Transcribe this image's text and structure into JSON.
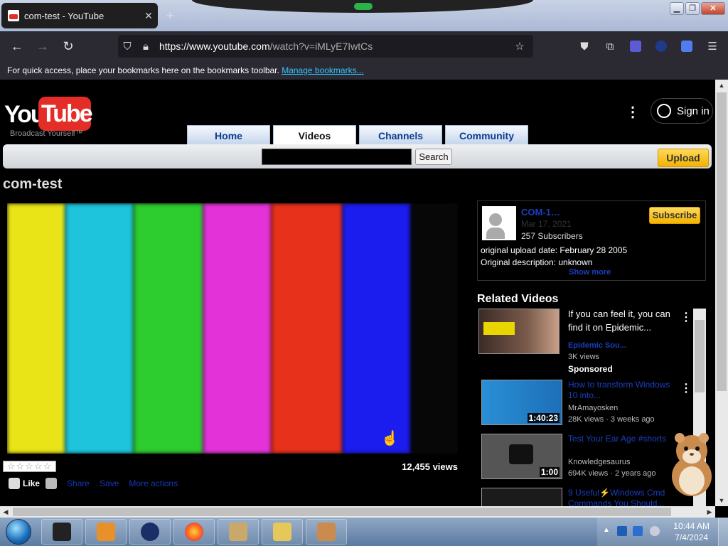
{
  "browser": {
    "tab_title": "com-test - YouTube",
    "url_domain": "https://www.youtube.com",
    "url_path": "/watch?v=iMLyE7IwtCs",
    "bookmarks_message": "For quick access, place your bookmarks here on the bookmarks toolbar.",
    "manage_bookmarks": "Manage bookmarks..."
  },
  "site": {
    "logo_you": "You",
    "logo_tube": "Tube",
    "tagline": "Broadcast Yourself™",
    "tabs": [
      {
        "label": "Home"
      },
      {
        "label": "Videos"
      },
      {
        "label": "Channels"
      },
      {
        "label": "Community"
      }
    ],
    "search_button": "Search",
    "upload_button": "Upload",
    "sign_in": "Sign in"
  },
  "video": {
    "channel_title": "com-test",
    "views": "12,455 views",
    "rating_stars": "☆☆☆☆☆",
    "like_label": "Like",
    "share_label": "Share",
    "save_label": "Save",
    "more_actions_label": "More actions",
    "bar_colors": [
      "#e8e417",
      "#1dc4dc",
      "#2dcc2f",
      "#e432d9",
      "#e8311a",
      "#1b1cee",
      "#070707"
    ]
  },
  "channel_info": {
    "name": "COM-1…",
    "date": "Mar 17, 2021",
    "subscribers": "257 Subscribers",
    "subscribe_button": "Subscribe",
    "upload_date_line": "original upload date: February 28 2005",
    "description_line": "Original description: unknown",
    "show_more": "Show more"
  },
  "related": {
    "header": "Related Videos",
    "items": [
      {
        "title": "If you can feel it, you can find it on Epidemic...",
        "channel": "Epidemic Sou...",
        "meta": "3K views",
        "badge": "Sponsored",
        "duration": ""
      },
      {
        "title": "How to transform Windows 10 into...",
        "channel": "MrAmayosken",
        "meta": "28K views · 3 weeks ago",
        "badge": "",
        "duration": "1:40:23"
      },
      {
        "title": "Test Your Ear Age #shorts",
        "channel": "Knowledgesaurus",
        "meta": "694K views · 2 years ago",
        "badge": "",
        "duration": "1:00"
      },
      {
        "title": "9 Useful⚡Windows Cmd Commands You Should...",
        "channel": "",
        "meta": "",
        "badge": "",
        "duration": ""
      }
    ]
  },
  "taskbar": {
    "time": "10:44 AM",
    "date": "7/4/2024"
  }
}
